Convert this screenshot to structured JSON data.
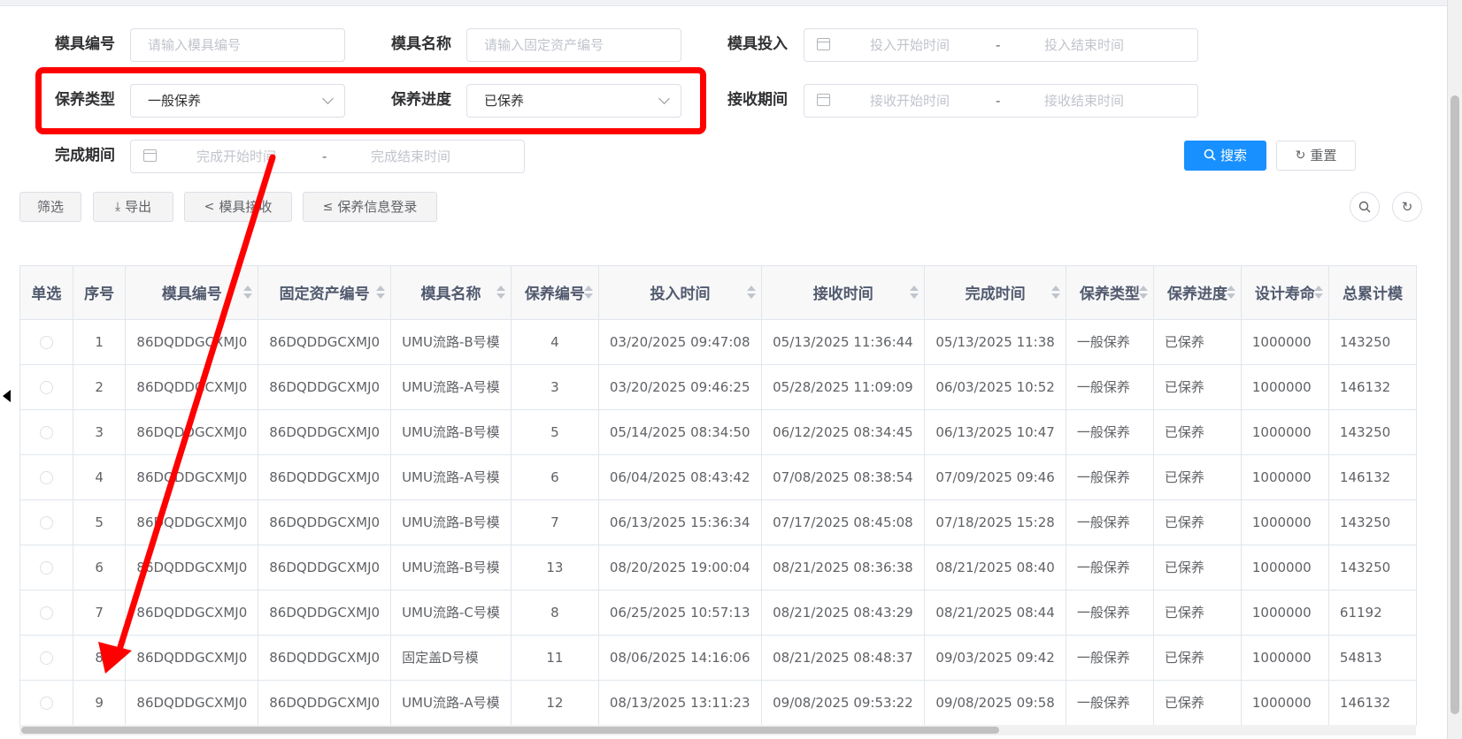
{
  "filters": {
    "mold_no_label": "模具编号",
    "mold_no_placeholder": "请输入模具编号",
    "mold_name_label": "模具名称",
    "mold_name_placeholder": "请输入固定资产编号",
    "input_period_label": "模具投入",
    "input_start_placeholder": "投入开始时间",
    "input_end_placeholder": "投入结束时间",
    "maint_type_label": "保养类型",
    "maint_type_value": "一般保养",
    "maint_progress_label": "保养进度",
    "maint_progress_value": "已保养",
    "receive_period_label": "接收期间",
    "receive_start_placeholder": "接收开始时间",
    "receive_end_placeholder": "接收结束时间",
    "complete_period_label": "完成期间",
    "complete_start_placeholder": "完成开始时间",
    "complete_end_placeholder": "完成结束时间",
    "range_separator": "-",
    "search_label": "搜索",
    "reset_label": "重置"
  },
  "toolbar": {
    "filter_label": "筛选",
    "export_label": "导出",
    "receive_label": "模具接收",
    "register_label": "保养信息登录"
  },
  "icons": {
    "search": "search-icon",
    "reset": "refresh-icon",
    "export": "download-icon",
    "share": "share-icon",
    "register": "edit-list-icon",
    "calendar": "calendar-icon"
  },
  "colors": {
    "primary": "#1890ff",
    "annotation": "#ff0000"
  },
  "table": {
    "headers": [
      "单选",
      "序号",
      "模具编号",
      "固定资产编号",
      "模具名称",
      "保养编号",
      "投入时间",
      "接收时间",
      "完成时间",
      "保养类型",
      "保养进度",
      "设计寿命",
      "总累计模"
    ],
    "rows": [
      [
        "1",
        "86DQDDGCXMJ0",
        "86DQDDGCXMJ0",
        "UMU流路-B号模",
        "4",
        "03/20/2025 09:47:08",
        "05/13/2025 11:36:44",
        "05/13/2025 11:38",
        "一般保养",
        "已保养",
        "1000000",
        "143250"
      ],
      [
        "2",
        "86DQDDGCXMJ0",
        "86DQDDGCXMJ0",
        "UMU流路-A号模",
        "3",
        "03/20/2025 09:46:25",
        "05/28/2025 11:09:09",
        "06/03/2025 10:52",
        "一般保养",
        "已保养",
        "1000000",
        "146132"
      ],
      [
        "3",
        "86DQDDGCXMJ0",
        "86DQDDGCXMJ0",
        "UMU流路-B号模",
        "5",
        "05/14/2025 08:34:50",
        "06/12/2025 08:34:45",
        "06/13/2025 10:47",
        "一般保养",
        "已保养",
        "1000000",
        "143250"
      ],
      [
        "4",
        "86DQDDGCXMJ0",
        "86DQDDGCXMJ0",
        "UMU流路-A号模",
        "6",
        "06/04/2025 08:43:42",
        "07/08/2025 08:38:54",
        "07/09/2025 09:46",
        "一般保养",
        "已保养",
        "1000000",
        "146132"
      ],
      [
        "5",
        "86DQDDGCXMJ0",
        "86DQDDGCXMJ0",
        "UMU流路-B号模",
        "7",
        "06/13/2025 15:36:34",
        "07/17/2025 08:45:08",
        "07/18/2025 15:28",
        "一般保养",
        "已保养",
        "1000000",
        "143250"
      ],
      [
        "6",
        "86DQDDGCXMJ0",
        "86DQDDGCXMJ0",
        "UMU流路-B号模",
        "13",
        "08/20/2025 19:00:04",
        "08/21/2025 08:36:38",
        "08/21/2025 08:40",
        "一般保养",
        "已保养",
        "1000000",
        "143250"
      ],
      [
        "7",
        "86DQDDGCXMJ0",
        "86DQDDGCXMJ0",
        "UMU流路-C号模",
        "8",
        "06/25/2025 10:57:13",
        "08/21/2025 08:43:29",
        "08/21/2025 08:44",
        "一般保养",
        "已保养",
        "1000000",
        "61192"
      ],
      [
        "8",
        "86DQDDGCXMJ0",
        "86DQDDGCXMJ0",
        "固定盖D号模",
        "11",
        "08/06/2025 14:16:06",
        "08/21/2025 08:48:37",
        "09/03/2025 09:42",
        "一般保养",
        "已保养",
        "1000000",
        "54813"
      ],
      [
        "9",
        "86DQDDGCXMJ0",
        "86DQDDGCXMJ0",
        "UMU流路-A号模",
        "12",
        "08/13/2025 13:11:23",
        "09/08/2025 09:53:22",
        "09/08/2025 09:58",
        "一般保养",
        "已保养",
        "1000000",
        "146132"
      ]
    ]
  }
}
